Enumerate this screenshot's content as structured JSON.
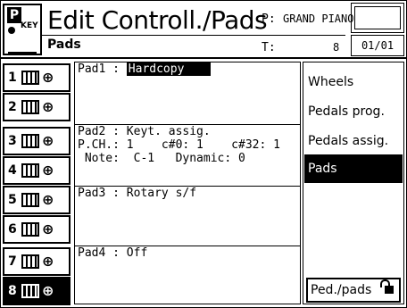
{
  "header": {
    "title": "Edit Controll./Pads",
    "subtitle": "Pads",
    "p_label": "P:",
    "p_value": "GRAND PIANO",
    "t_label": "T:",
    "t_value": "8",
    "page": "01/01",
    "logo_text": "KEY"
  },
  "tracks": [
    {
      "num": "1",
      "active": false
    },
    {
      "num": "2",
      "active": false
    },
    {
      "num": "3",
      "active": false
    },
    {
      "num": "4",
      "active": false
    },
    {
      "num": "5",
      "active": false
    },
    {
      "num": "6",
      "active": false
    },
    {
      "num": "7",
      "active": false
    },
    {
      "num": "8",
      "active": true
    }
  ],
  "pads": {
    "pad1": {
      "label": "Pad1 : ",
      "value": "Hardcopy"
    },
    "pad2": {
      "line1": "Pad2 : Keyt. assig.",
      "line2": "P.CH.: 1    c#0: 1    c#32: 1",
      "line3": " Note:  C-1   Dynamic: 0"
    },
    "pad3": {
      "line1": "Pad3 : Rotary s/f"
    },
    "pad4": {
      "line1": "Pad4 : Off"
    }
  },
  "menu": {
    "items": [
      "Wheels",
      "Pedals prog.",
      "Pedals assig.",
      "Pads"
    ],
    "active_index": 3,
    "bottom_button": "Ped./pads"
  }
}
